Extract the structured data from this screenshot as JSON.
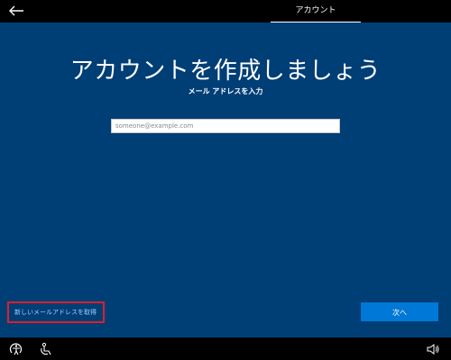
{
  "header": {
    "tab_label": "アカウント"
  },
  "main": {
    "title": "アカウントを作成しましょう",
    "subtitle": "メール アドレスを入力",
    "email_input": {
      "value": "",
      "placeholder": "someone@example.com"
    },
    "new_address_link": "新しいメールアドレスを取得",
    "next_button": "次へ"
  },
  "icons": {
    "back": "back-arrow-icon",
    "ease_of_access": "ease-of-access-icon",
    "accessibility": "accessibility-person-icon",
    "volume": "volume-icon"
  },
  "colors": {
    "panel_background": "#003e76",
    "button_accent": "#0078d7",
    "highlight_border": "#d8212f",
    "link_text": "#9ed0ff"
  }
}
